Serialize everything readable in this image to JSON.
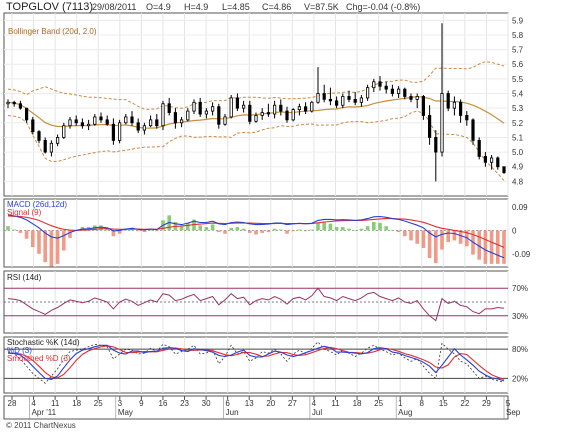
{
  "header": {
    "title": "TOPGLOV (7113)",
    "date": "29/08/2011",
    "open": "O=4.9",
    "high": "H=4.9",
    "low": "L=4.85",
    "close": "C=4.86",
    "volume": "V=87.5K",
    "change": "Chg=-0.04 (-0.8%)"
  },
  "footer": "© 2011 ChartNexus",
  "chart_data": [
    {
      "type": "candlestick",
      "legend": [
        "Bollinger Band (20d, 2.0)"
      ],
      "y_ticks": [
        "4.8",
        "4.9",
        "5.0",
        "5.1",
        "5.2",
        "5.3",
        "5.4",
        "5.5",
        "5.6",
        "5.7",
        "5.8",
        "5.9"
      ],
      "ylim": [
        4.7,
        5.95
      ],
      "x_ticks": [
        "28",
        "4",
        "11",
        "18",
        "25",
        "3",
        "9",
        "16",
        "23",
        "30",
        "6",
        "13",
        "20",
        "27",
        "4",
        "11",
        "18",
        "25",
        "1",
        "8",
        "15",
        "22",
        "29",
        "5"
      ],
      "month_labels": [
        "Apr '11",
        "May",
        "Jun",
        "Jul",
        "Aug",
        "Sep"
      ],
      "ohlc": [
        [
          5.33,
          5.36,
          5.3,
          5.34
        ],
        [
          5.34,
          5.35,
          5.31,
          5.33
        ],
        [
          5.33,
          5.35,
          5.29,
          5.3
        ],
        [
          5.3,
          5.3,
          5.2,
          5.22
        ],
        [
          5.22,
          5.24,
          5.12,
          5.14
        ],
        [
          5.14,
          5.15,
          5.06,
          5.08
        ],
        [
          5.08,
          5.1,
          4.99,
          5.0
        ],
        [
          5.0,
          5.08,
          4.97,
          5.06
        ],
        [
          5.06,
          5.12,
          5.04,
          5.1
        ],
        [
          5.1,
          5.2,
          5.09,
          5.18
        ],
        [
          5.18,
          5.24,
          5.16,
          5.22
        ],
        [
          5.22,
          5.25,
          5.18,
          5.2
        ],
        [
          5.2,
          5.23,
          5.16,
          5.18
        ],
        [
          5.18,
          5.22,
          5.15,
          5.19
        ],
        [
          5.19,
          5.26,
          5.18,
          5.24
        ],
        [
          5.24,
          5.27,
          5.2,
          5.22
        ],
        [
          5.22,
          5.25,
          5.18,
          5.19
        ],
        [
          5.19,
          5.23,
          5.05,
          5.08
        ],
        [
          5.08,
          5.22,
          5.06,
          5.2
        ],
        [
          5.2,
          5.26,
          5.19,
          5.24
        ],
        [
          5.24,
          5.28,
          5.18,
          5.2
        ],
        [
          5.2,
          5.23,
          5.13,
          5.15
        ],
        [
          5.15,
          5.2,
          5.12,
          5.18
        ],
        [
          5.18,
          5.25,
          5.17,
          5.22
        ],
        [
          5.22,
          5.26,
          5.16,
          5.18
        ],
        [
          5.18,
          5.35,
          5.15,
          5.33
        ],
        [
          5.33,
          5.37,
          5.25,
          5.27
        ],
        [
          5.27,
          5.3,
          5.16,
          5.2
        ],
        [
          5.2,
          5.24,
          5.17,
          5.22
        ],
        [
          5.22,
          5.3,
          5.21,
          5.28
        ],
        [
          5.28,
          5.36,
          5.26,
          5.34
        ],
        [
          5.34,
          5.37,
          5.24,
          5.26
        ],
        [
          5.26,
          5.3,
          5.23,
          5.28
        ],
        [
          5.28,
          5.34,
          5.25,
          5.31
        ],
        [
          5.31,
          5.33,
          5.16,
          5.19
        ],
        [
          5.19,
          5.26,
          5.18,
          5.24
        ],
        [
          5.24,
          5.39,
          5.23,
          5.37
        ],
        [
          5.37,
          5.4,
          5.28,
          5.3
        ],
        [
          5.3,
          5.35,
          5.27,
          5.32
        ],
        [
          5.32,
          5.35,
          5.19,
          5.21
        ],
        [
          5.21,
          5.27,
          5.2,
          5.25
        ],
        [
          5.25,
          5.3,
          5.22,
          5.27
        ],
        [
          5.27,
          5.33,
          5.24,
          5.26
        ],
        [
          5.26,
          5.35,
          5.23,
          5.32
        ],
        [
          5.32,
          5.36,
          5.25,
          5.28
        ],
        [
          5.28,
          5.31,
          5.2,
          5.22
        ],
        [
          5.22,
          5.3,
          5.21,
          5.29
        ],
        [
          5.29,
          5.33,
          5.25,
          5.31
        ],
        [
          5.31,
          5.34,
          5.26,
          5.28
        ],
        [
          5.28,
          5.35,
          5.27,
          5.34
        ],
        [
          5.34,
          5.58,
          5.33,
          5.4
        ],
        [
          5.4,
          5.46,
          5.34,
          5.36
        ],
        [
          5.36,
          5.44,
          5.32,
          5.35
        ],
        [
          5.35,
          5.38,
          5.3,
          5.32
        ],
        [
          5.32,
          5.4,
          5.3,
          5.38
        ],
        [
          5.38,
          5.42,
          5.34,
          5.36
        ],
        [
          5.36,
          5.41,
          5.32,
          5.34
        ],
        [
          5.34,
          5.39,
          5.31,
          5.37
        ],
        [
          5.37,
          5.46,
          5.35,
          5.44
        ],
        [
          5.44,
          5.5,
          5.41,
          5.48
        ],
        [
          5.48,
          5.52,
          5.42,
          5.45
        ],
        [
          5.45,
          5.48,
          5.4,
          5.43
        ],
        [
          5.43,
          5.46,
          5.38,
          5.4
        ],
        [
          5.4,
          5.45,
          5.37,
          5.43
        ],
        [
          5.43,
          5.44,
          5.36,
          5.38
        ],
        [
          5.38,
          5.4,
          5.34,
          5.36
        ],
        [
          5.36,
          5.4,
          5.3,
          5.38
        ],
        [
          5.38,
          5.39,
          5.22,
          5.25
        ],
        [
          5.25,
          5.32,
          5.05,
          5.1
        ],
        [
          5.1,
          5.15,
          4.8,
          5.0
        ],
        [
          5.0,
          5.88,
          4.97,
          5.4
        ],
        [
          5.4,
          5.42,
          5.28,
          5.3
        ],
        [
          5.3,
          5.38,
          5.25,
          5.34
        ],
        [
          5.34,
          5.36,
          5.2,
          5.25
        ],
        [
          5.25,
          5.28,
          5.18,
          5.22
        ],
        [
          5.22,
          5.23,
          5.05,
          5.08
        ],
        [
          5.08,
          5.1,
          4.95,
          4.97
        ],
        [
          4.97,
          5.0,
          4.9,
          4.93
        ],
        [
          4.93,
          4.98,
          4.88,
          4.96
        ],
        [
          4.96,
          4.97,
          4.88,
          4.9
        ],
        [
          4.9,
          4.9,
          4.85,
          4.86
        ]
      ]
    },
    {
      "type": "line",
      "legend": [
        "MACD (26d,12d)",
        "Signal (9)"
      ],
      "y_ticks": [
        "0.09",
        "0",
        "-0.09"
      ],
      "ylim": [
        -0.14,
        0.12
      ],
      "macd": [
        0.06,
        0.055,
        0.05,
        0.04,
        0.025,
        0.01,
        -0.01,
        -0.025,
        -0.03,
        -0.02,
        -0.008,
        0.0,
        0.005,
        0.006,
        0.01,
        0.012,
        0.01,
        -0.002,
        0.0,
        0.005,
        0.008,
        0.004,
        0.002,
        0.005,
        0.003,
        0.02,
        0.03,
        0.025,
        0.022,
        0.028,
        0.035,
        0.03,
        0.03,
        0.035,
        0.025,
        0.022,
        0.03,
        0.032,
        0.03,
        0.025,
        0.022,
        0.023,
        0.024,
        0.028,
        0.028,
        0.022,
        0.025,
        0.027,
        0.025,
        0.027,
        0.038,
        0.042,
        0.042,
        0.04,
        0.041,
        0.04,
        0.038,
        0.04,
        0.045,
        0.052,
        0.053,
        0.05,
        0.045,
        0.042,
        0.036,
        0.028,
        0.02,
        0.01,
        -0.01,
        -0.025,
        -0.015,
        -0.01,
        -0.012,
        -0.02,
        -0.028,
        -0.045,
        -0.06,
        -0.075,
        -0.085,
        -0.095,
        -0.105
      ],
      "signal": [
        0.055,
        0.054,
        0.053,
        0.05,
        0.045,
        0.038,
        0.028,
        0.018,
        0.01,
        0.004,
        0.001,
        0.0,
        0.001,
        0.002,
        0.004,
        0.006,
        0.007,
        0.005,
        0.004,
        0.004,
        0.005,
        0.005,
        0.004,
        0.005,
        0.004,
        0.008,
        0.012,
        0.015,
        0.017,
        0.019,
        0.022,
        0.024,
        0.026,
        0.028,
        0.027,
        0.026,
        0.027,
        0.028,
        0.028,
        0.028,
        0.027,
        0.026,
        0.026,
        0.026,
        0.027,
        0.026,
        0.026,
        0.026,
        0.026,
        0.026,
        0.029,
        0.032,
        0.034,
        0.036,
        0.037,
        0.038,
        0.038,
        0.038,
        0.04,
        0.042,
        0.044,
        0.045,
        0.045,
        0.044,
        0.043,
        0.04,
        0.036,
        0.031,
        0.023,
        0.014,
        0.008,
        0.004,
        0.0,
        -0.004,
        -0.009,
        -0.016,
        -0.025,
        -0.035,
        -0.045,
        -0.055,
        -0.065
      ]
    },
    {
      "type": "line",
      "legend": [
        "RSI (14d)"
      ],
      "y_ticks": [
        "70%",
        "30%"
      ],
      "ylim": [
        5,
        95
      ],
      "values": [
        55,
        54,
        52,
        46,
        40,
        36,
        32,
        38,
        42,
        48,
        53,
        51,
        49,
        51,
        56,
        53,
        50,
        40,
        50,
        54,
        51,
        45,
        49,
        53,
        50,
        62,
        60,
        52,
        54,
        58,
        61,
        52,
        55,
        58,
        46,
        53,
        62,
        55,
        57,
        46,
        52,
        55,
        53,
        58,
        54,
        47,
        55,
        57,
        53,
        59,
        70,
        58,
        56,
        52,
        58,
        55,
        52,
        56,
        62,
        64,
        58,
        55,
        52,
        56,
        50,
        48,
        52,
        40,
        30,
        23,
        55,
        48,
        51,
        45,
        43,
        36,
        33,
        40,
        40,
        42,
        41
      ]
    },
    {
      "type": "line",
      "legend": [
        "Stochastic %K (14d)",
        "%D (3)",
        "Smoothed %D (3)"
      ],
      "y_ticks": [
        "80%",
        "20%"
      ],
      "ylim": [
        -10,
        105
      ],
      "k": [
        75,
        70,
        60,
        45,
        30,
        20,
        10,
        25,
        40,
        60,
        75,
        78,
        80,
        85,
        90,
        88,
        85,
        60,
        70,
        80,
        78,
        70,
        72,
        82,
        75,
        90,
        85,
        70,
        75,
        80,
        88,
        70,
        72,
        80,
        50,
        65,
        88,
        70,
        75,
        55,
        62,
        75,
        72,
        80,
        70,
        55,
        70,
        78,
        70,
        82,
        95,
        80,
        75,
        68,
        78,
        72,
        65,
        72,
        82,
        88,
        80,
        75,
        68,
        72,
        62,
        55,
        60,
        45,
        30,
        20,
        92,
        80,
        70,
        55,
        50,
        35,
        20,
        25,
        18,
        15,
        12
      ],
      "d": [
        72,
        71,
        68,
        58,
        45,
        32,
        20,
        18,
        25,
        42,
        58,
        71,
        78,
        81,
        85,
        88,
        88,
        78,
        72,
        70,
        76,
        76,
        73,
        75,
        76,
        82,
        83,
        82,
        77,
        75,
        81,
        79,
        77,
        74,
        67,
        65,
        68,
        74,
        78,
        67,
        64,
        64,
        70,
        76,
        74,
        68,
        65,
        68,
        73,
        77,
        82,
        86,
        83,
        74,
        74,
        73,
        72,
        70,
        73,
        81,
        83,
        81,
        74,
        72,
        67,
        63,
        59,
        53,
        45,
        32,
        47,
        64,
        81,
        68,
        58,
        47,
        35,
        27,
        21,
        19,
        15
      ]
    }
  ]
}
